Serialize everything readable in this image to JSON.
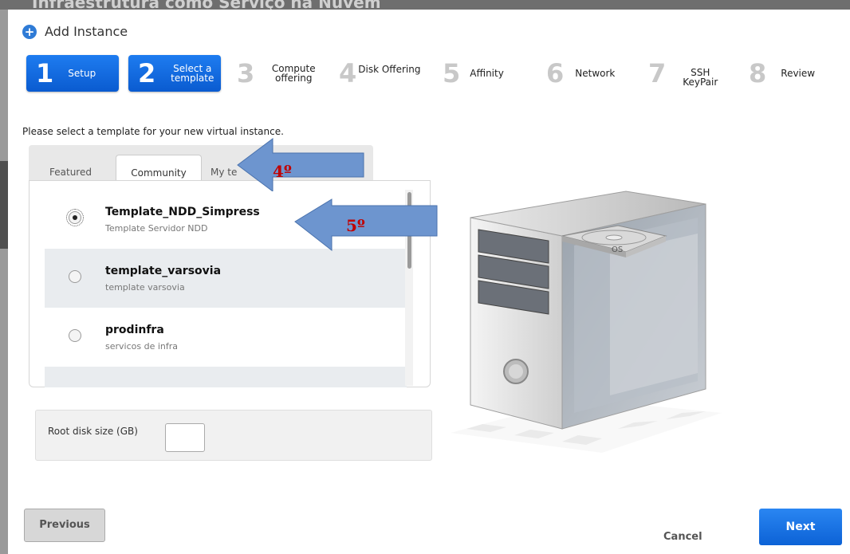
{
  "background_title": "Infraestrutura como Serviço na Nuvem",
  "dialog": {
    "title": "Add Instance",
    "icon": "plus-circle-icon"
  },
  "steps": [
    {
      "num": "1",
      "label": "Setup",
      "state": "active"
    },
    {
      "num": "2",
      "label": "Select a template",
      "state": "active"
    },
    {
      "num": "3",
      "label": "Compute offering",
      "state": "inactive"
    },
    {
      "num": "4",
      "label": "Disk Offering",
      "state": "inactive"
    },
    {
      "num": "5",
      "label": "Affinity",
      "state": "inactive"
    },
    {
      "num": "6",
      "label": "Network",
      "state": "inactive"
    },
    {
      "num": "7",
      "label": "SSH KeyPair",
      "state": "inactive"
    },
    {
      "num": "8",
      "label": "Review",
      "state": "inactive"
    }
  ],
  "instruction": "Please select a template for your new virtual instance.",
  "tabs": [
    {
      "label": "Featured",
      "active": false
    },
    {
      "label": "Community",
      "active": true
    },
    {
      "label": "My te",
      "active": false
    }
  ],
  "templates": [
    {
      "name": "Template_NDD_Simpress",
      "desc": "Template Servidor NDD",
      "selected": true
    },
    {
      "name": "template_varsovia",
      "desc": "template varsovia",
      "selected": false
    },
    {
      "name": "prodinfra",
      "desc": "servicos de infra",
      "selected": false
    }
  ],
  "disk": {
    "label": "Root disk size (GB)",
    "value": ""
  },
  "illustration": {
    "os_label": "OS"
  },
  "annotations": {
    "arrow1": "4º",
    "arrow2": "5º"
  },
  "buttons": {
    "previous": "Previous",
    "cancel": "Cancel",
    "next": "Next"
  },
  "colors": {
    "accent": "#1e7cf0",
    "annotation_arrow": "#6d95cf",
    "annotation_text": "#c00000"
  }
}
